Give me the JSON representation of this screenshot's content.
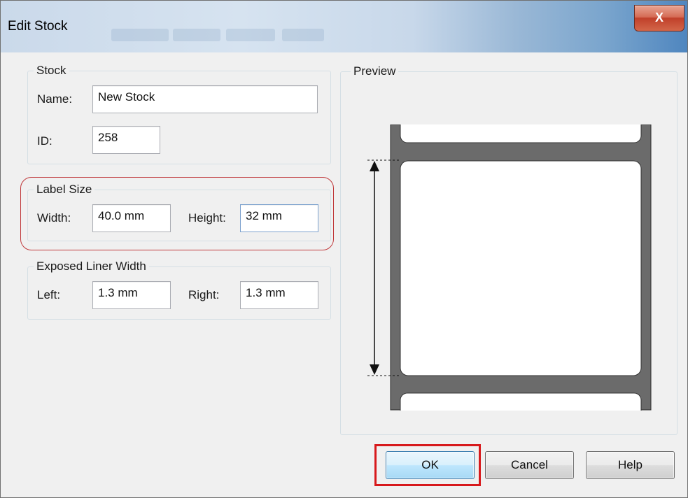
{
  "window": {
    "title": "Edit Stock",
    "close_glyph": "X"
  },
  "stock": {
    "legend": "Stock",
    "name_label": "Name:",
    "name_value": "New Stock",
    "id_label": "ID:",
    "id_value": "258"
  },
  "label_size": {
    "legend": "Label Size",
    "width_label": "Width:",
    "width_value": "40.0 mm",
    "height_label": "Height:",
    "height_value": "32 mm"
  },
  "liner": {
    "legend": "Exposed Liner Width",
    "left_label": "Left:",
    "left_value": "1.3 mm",
    "right_label": "Right:",
    "right_value": "1.3 mm"
  },
  "preview": {
    "legend": "Preview"
  },
  "buttons": {
    "ok": "OK",
    "cancel": "Cancel",
    "help": "Help"
  },
  "colors": {
    "highlight_red": "#d7191c",
    "liner_gray": "#6b6b6b",
    "default_button_blue": "#3c7fb1"
  },
  "icons": [
    "close-icon",
    "arrow-up-icon",
    "arrow-down-icon"
  ]
}
